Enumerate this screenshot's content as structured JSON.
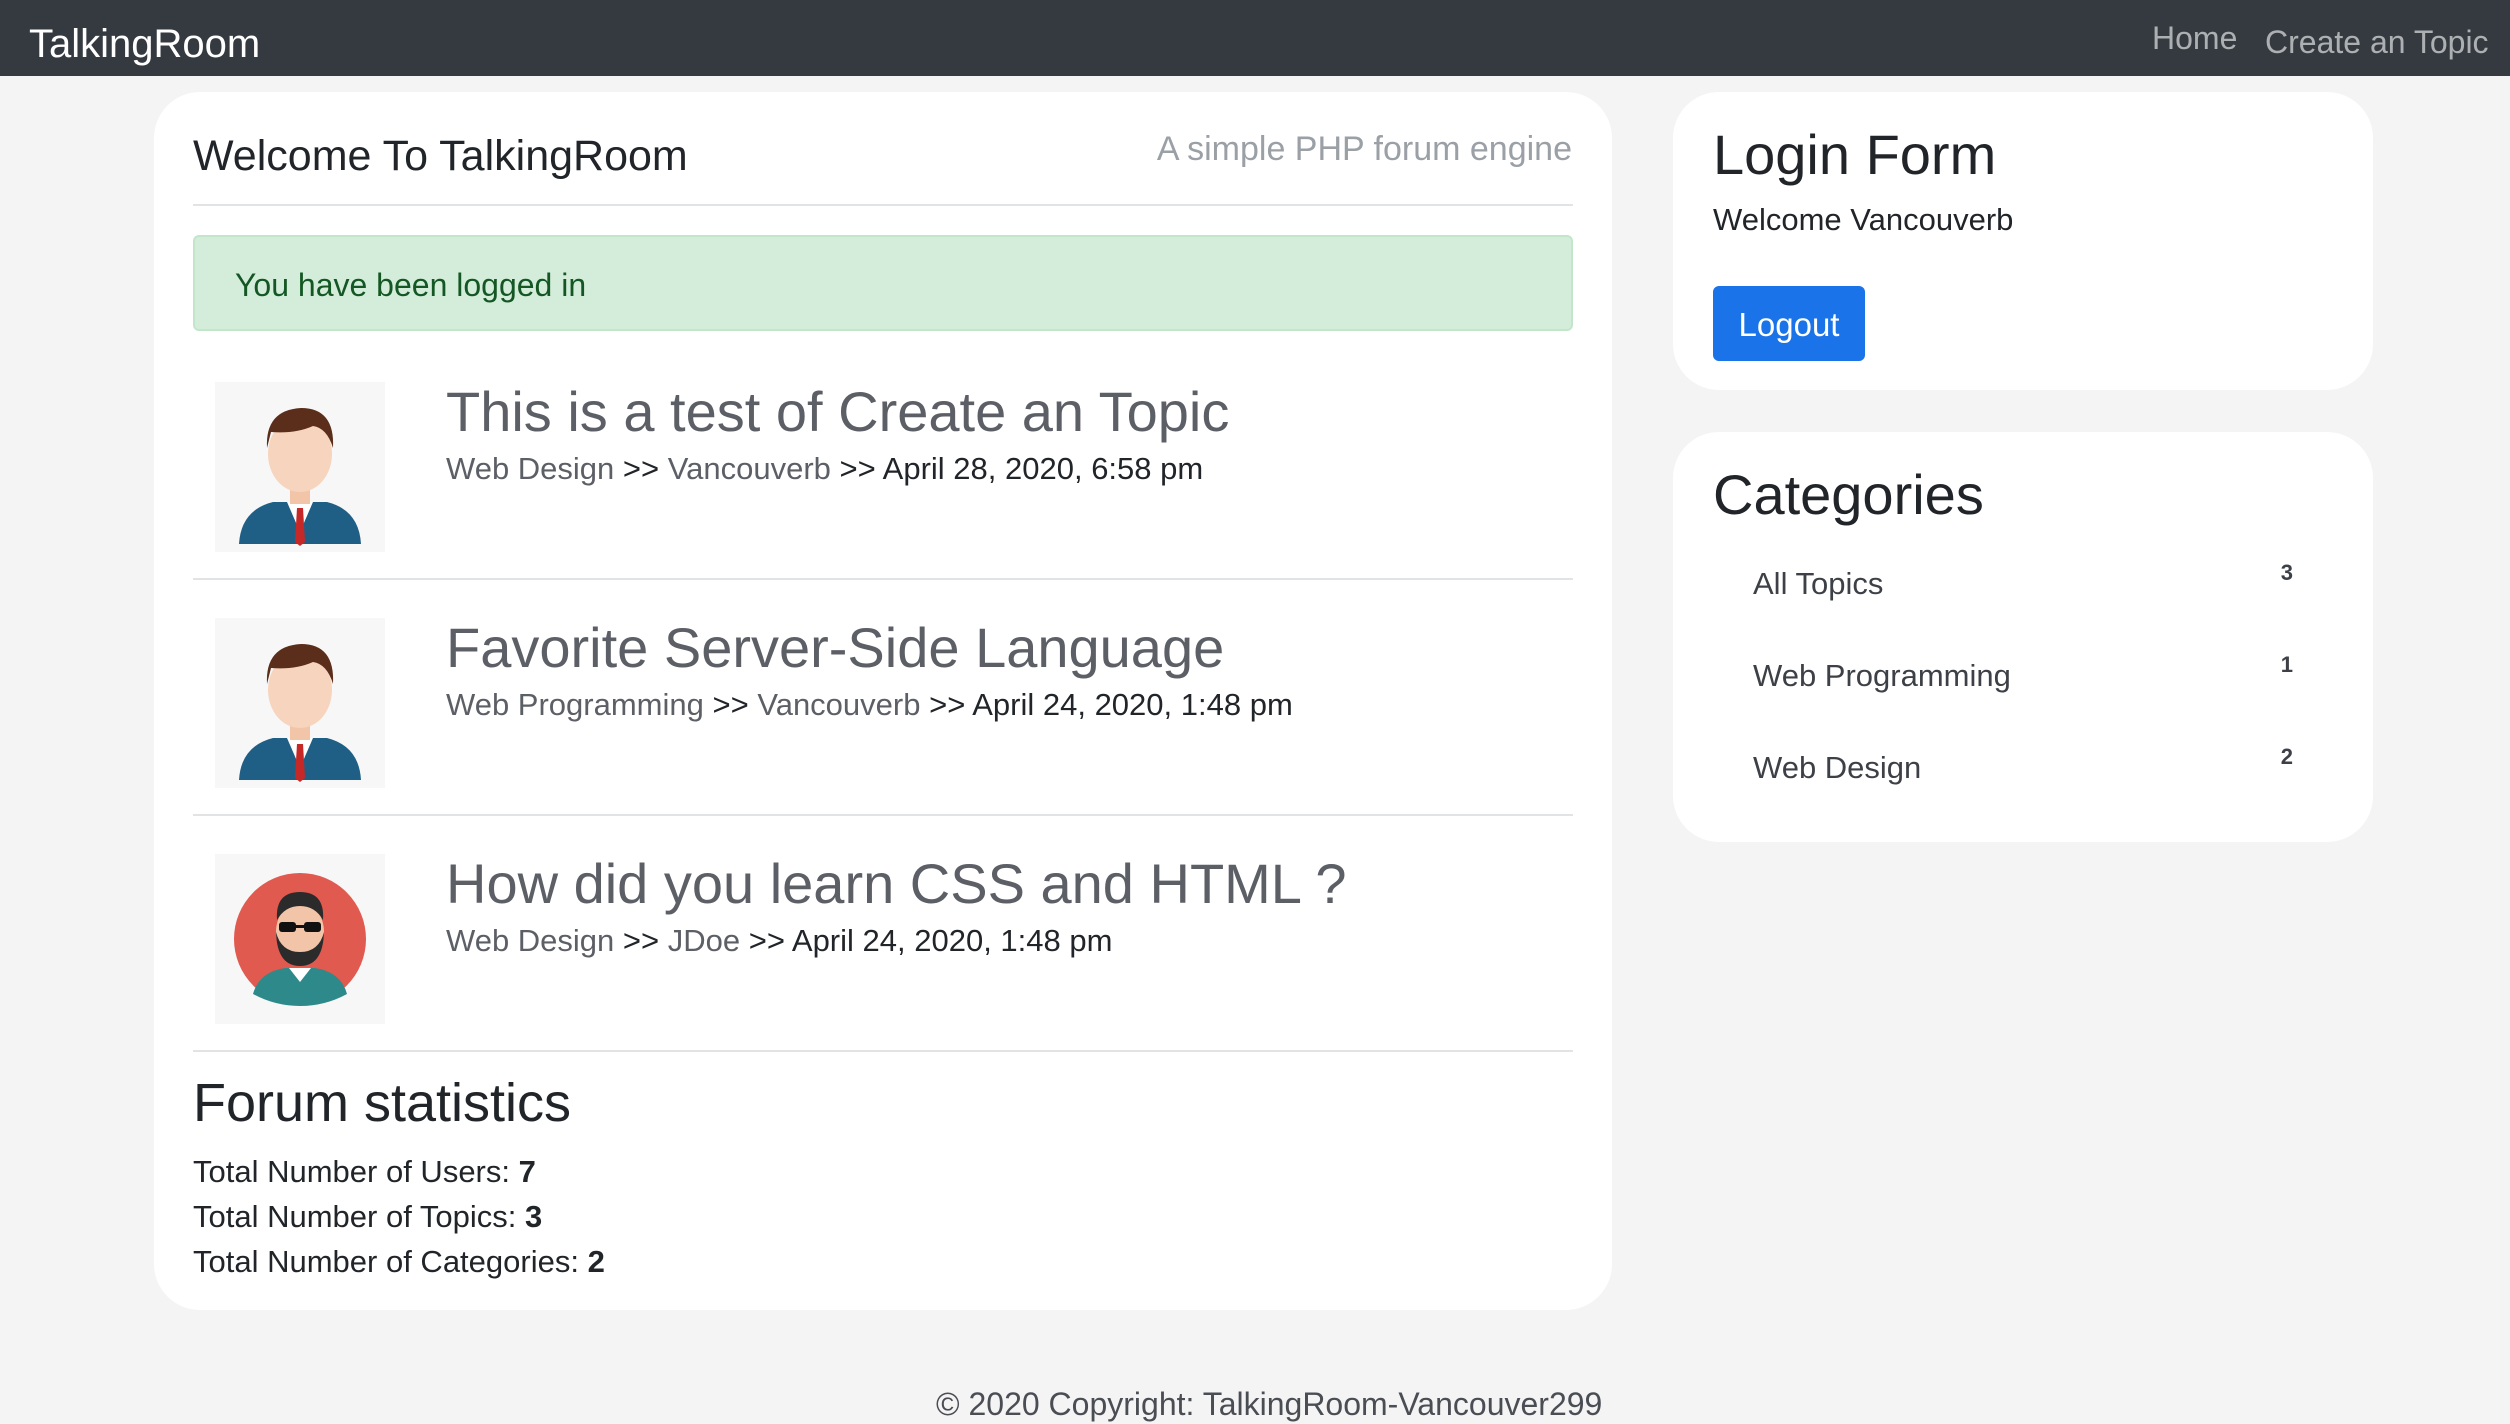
{
  "navbar": {
    "brand": "TalkingRoom",
    "links": [
      {
        "label": "Home"
      },
      {
        "label": "Create an Topic"
      }
    ]
  },
  "main": {
    "title": "Welcome To TalkingRoom",
    "tagline": "A simple PHP forum engine",
    "alert": "You have been logged in",
    "topics": [
      {
        "title": "This is a test of Create an Topic",
        "category": "Web Design",
        "author": "Vancouverb",
        "date": "April 28, 2020, 6:58 pm",
        "avatar": "male-avatar-icon"
      },
      {
        "title": "Favorite Server-Side Language",
        "category": "Web Programming",
        "author": "Vancouverb",
        "date": "April 24, 2020, 1:48 pm",
        "avatar": "male-avatar-icon"
      },
      {
        "title": "How did you learn CSS and HTML ?",
        "category": "Web Design",
        "author": "JDoe",
        "date": "April 24, 2020, 1:48 pm",
        "avatar": "bearded-avatar-icon"
      }
    ],
    "separator": ">>",
    "stats": {
      "title": "Forum statistics",
      "users_label": "Total Number of Users: ",
      "users_value": "7",
      "topics_label": "Total Number of Topics: ",
      "topics_value": "3",
      "categories_label": "Total Number of Categories: ",
      "categories_value": "2"
    }
  },
  "login": {
    "title": "Login Form",
    "welcome": "Welcome Vancouverb",
    "logout_label": "Logout",
    "button_color": "#1a73e8"
  },
  "categories": {
    "title": "Categories",
    "items": [
      {
        "label": "All Topics",
        "count": "3"
      },
      {
        "label": "Web Programming",
        "count": "1"
      },
      {
        "label": "Web Design",
        "count": "2"
      }
    ]
  },
  "footer": {
    "text": "© 2020 Copyright: TalkingRoom-Vancouver299"
  }
}
